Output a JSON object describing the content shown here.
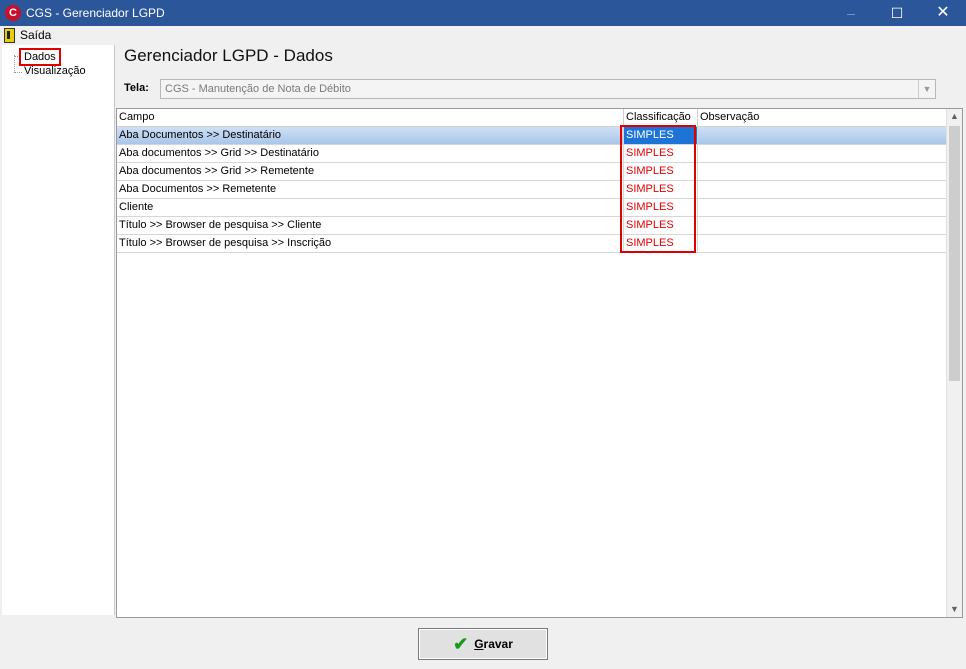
{
  "window": {
    "title": "CGS - Gerenciador LGPD",
    "icon_letter": "C"
  },
  "menu": {
    "exit_label": "Saída"
  },
  "tree": {
    "items": [
      {
        "label": "Dados",
        "selected": true
      },
      {
        "label": "Visualização",
        "selected": false
      }
    ]
  },
  "page": {
    "heading": "Gerenciador LGPD - Dados"
  },
  "tela": {
    "label": "Tela:",
    "value": "CGS - Manutenção de Nota de Débito"
  },
  "grid": {
    "columns": [
      "Campo",
      "Classificação",
      "Observação"
    ],
    "rows": [
      {
        "campo": "Aba Documentos >> Destinatário",
        "classificacao": "SIMPLES",
        "observacao": "",
        "selected": true
      },
      {
        "campo": "Aba documentos >> Grid  >> Destinatário",
        "classificacao": "SIMPLES",
        "observacao": ""
      },
      {
        "campo": "Aba documentos >> Grid  >> Remetente",
        "classificacao": "SIMPLES",
        "observacao": ""
      },
      {
        "campo": "Aba Documentos >> Remetente",
        "classificacao": "SIMPLES",
        "observacao": ""
      },
      {
        "campo": "Cliente",
        "classificacao": "SIMPLES",
        "observacao": ""
      },
      {
        "campo": "Título >> Browser de pesquisa >> Cliente",
        "classificacao": "SIMPLES",
        "observacao": ""
      },
      {
        "campo": "Título >> Browser de pesquisa >> Inscrição",
        "classificacao": "SIMPLES",
        "observacao": ""
      }
    ]
  },
  "footer": {
    "save_label_first": "G",
    "save_label_rest": "ravar"
  },
  "colors": {
    "titlebar": "#2b579a",
    "highlight": "#e00000",
    "selected_cell": "#1e74d6",
    "check": "#1a9c1a"
  }
}
